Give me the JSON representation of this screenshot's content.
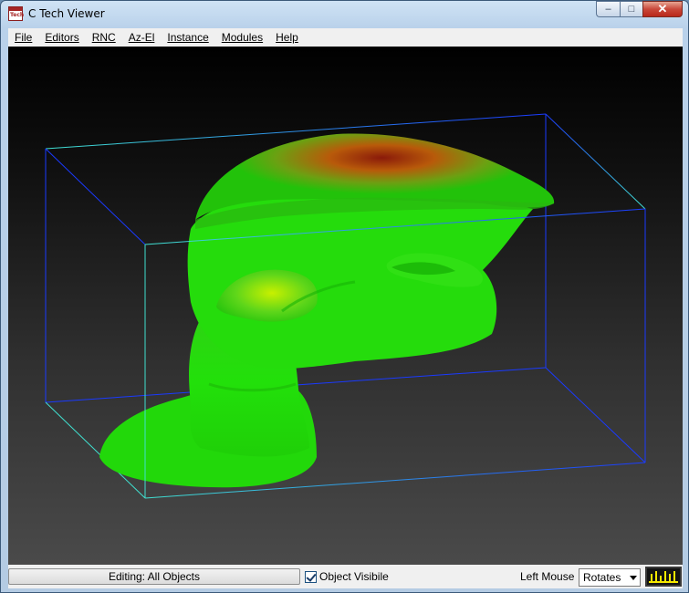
{
  "window": {
    "title": "C Tech Viewer",
    "minimize_glyph": "–",
    "maximize_glyph": "□",
    "close_glyph": "✕"
  },
  "menu": {
    "items": [
      {
        "label": "File"
      },
      {
        "label": "Editors"
      },
      {
        "label": "RNC"
      },
      {
        "label": "Az-El"
      },
      {
        "label": "Instance"
      },
      {
        "label": "Modules"
      },
      {
        "label": "Help"
      }
    ]
  },
  "viewport": {
    "background_top": "#000000",
    "background_bottom": "#4a4a4a",
    "bounding_box_color": "#1a3aff",
    "bounding_box_highlight": "#40e0d0",
    "isosurface_colors": [
      "#22e00a",
      "#5ed61a",
      "#c8e000",
      "#b85a0a",
      "#8a1a0a"
    ]
  },
  "statusbar": {
    "editing_label": "Editing: All Objects",
    "object_visible_label": "Object Visibile",
    "object_visible_checked": true,
    "left_mouse_label": "Left Mouse",
    "left_mouse_value": "Rotates",
    "meter_color": "#f5e800"
  },
  "icons": {
    "app": "ctech-app-icon",
    "meter": "audio-meter-icon"
  }
}
